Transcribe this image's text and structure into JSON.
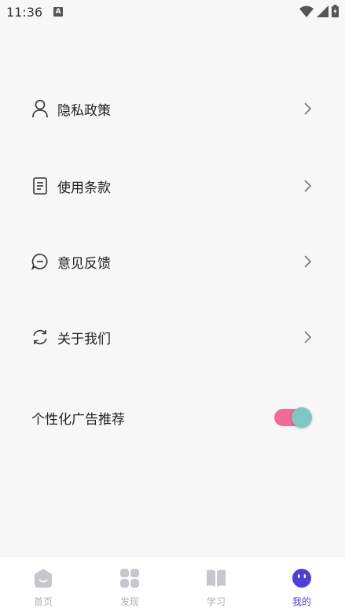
{
  "status_bar": {
    "time": "11:36",
    "badge": "A"
  },
  "menu": {
    "items": [
      {
        "label": "隐私政策",
        "icon": "person-icon"
      },
      {
        "label": "使用条款",
        "icon": "document-icon"
      },
      {
        "label": "意见反馈",
        "icon": "chat-bubble-icon"
      },
      {
        "label": "关于我们",
        "icon": "refresh-icon"
      }
    ]
  },
  "ad_toggle": {
    "label": "个性化广告推荐",
    "on": true,
    "track_color": "#f06b95",
    "knob_color": "#7ec8c0"
  },
  "tabbar": {
    "tabs": [
      {
        "label": "首页",
        "icon": "home-icon",
        "active": false
      },
      {
        "label": "发现",
        "icon": "grid-icon",
        "active": false
      },
      {
        "label": "学习",
        "icon": "book-icon",
        "active": false
      },
      {
        "label": "我的",
        "icon": "smiley-icon",
        "active": true
      }
    ],
    "inactive_color": "#c6c6cc",
    "active_color": "#4f3fd8"
  }
}
